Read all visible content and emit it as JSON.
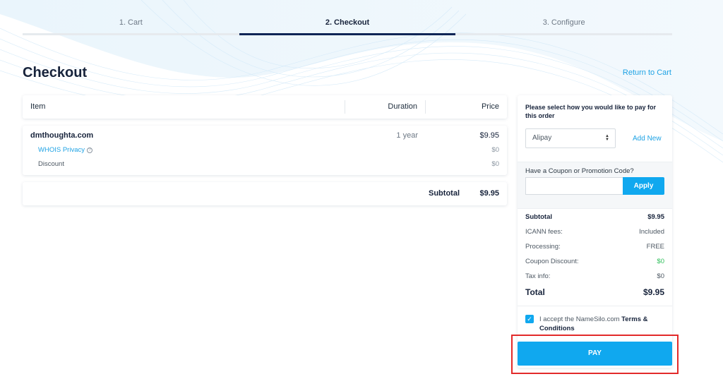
{
  "steps": [
    {
      "label": "1. Cart"
    },
    {
      "label": "2. Checkout"
    },
    {
      "label": "3. Configure"
    }
  ],
  "page": {
    "title": "Checkout",
    "return_link": "Return to Cart"
  },
  "table": {
    "headers": {
      "item": "Item",
      "duration": "Duration",
      "price": "Price"
    },
    "row": {
      "domain": "dmthoughta.com",
      "duration": "1 year",
      "price": "$9.95",
      "whois_label": "WHOIS Privacy",
      "whois_price": "$0",
      "discount_label": "Discount",
      "discount_price": "$0"
    },
    "subtotal": {
      "label": "Subtotal",
      "value": "$9.95"
    }
  },
  "sidebar": {
    "payment_prompt": "Please select how you would like to pay for this order",
    "payment_method": "Alipay",
    "add_new": "Add New",
    "coupon_label": "Have a Coupon or Promotion Code?",
    "coupon_value": "",
    "apply_label": "Apply",
    "summary": {
      "subtotal": {
        "label": "Subtotal",
        "value": "$9.95"
      },
      "icann": {
        "label": "ICANN fees:",
        "value": "Included"
      },
      "processing": {
        "label": "Processing:",
        "value": "FREE"
      },
      "coupon_discount": {
        "label": "Coupon Discount:",
        "value": "$0"
      },
      "tax": {
        "label": "Tax info:",
        "value": "$0"
      },
      "total": {
        "label": "Total",
        "value": "$9.95"
      }
    },
    "accept_prefix": "I accept the NameSilo.com",
    "accept_terms": "Terms & Conditions",
    "accept_checked": true,
    "pay_label": "PAY"
  },
  "colors": {
    "accent": "#10a8ef",
    "link": "#1ea2e4",
    "active_step": "#0f2556",
    "highlight": "#e22a2a",
    "discount_green": "#2fbf5b"
  }
}
